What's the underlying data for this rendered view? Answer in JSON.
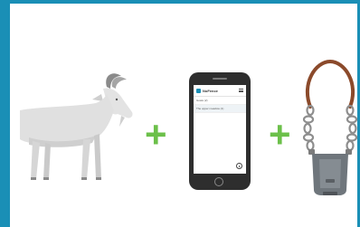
{
  "colors": {
    "frame": "#1a8fb6",
    "goat": "#dcdcdc",
    "plus": "#6cc04a",
    "phone": "#2e2e2e",
    "strap": "#8b4a2b",
    "chain": "#8e8e8e",
    "device": "#6f767c"
  },
  "plus_signs": [
    "+",
    "+"
  ],
  "app": {
    "title": "NoFence",
    "items": [
      "Goats (2)",
      "The upper meadow (1)"
    ]
  },
  "icons": {
    "goat": "goat-illustration",
    "phone": "smartphone-icon",
    "collar": "gps-collar-icon",
    "menu": "hamburger-menu-icon",
    "fab": "play-icon"
  }
}
